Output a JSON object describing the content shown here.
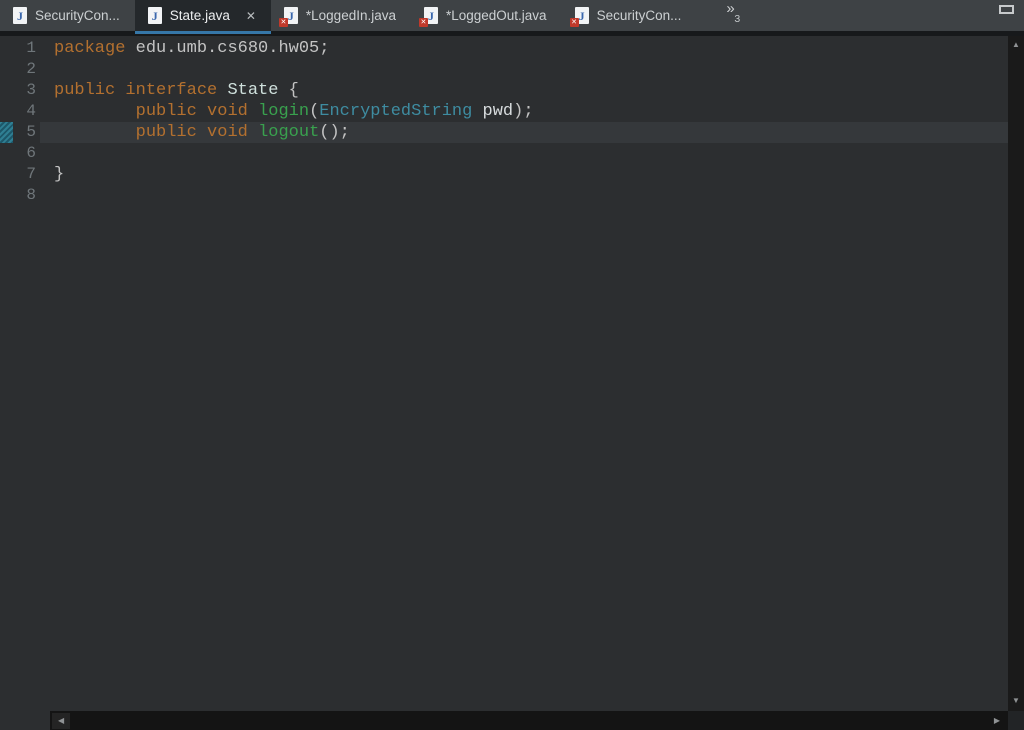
{
  "tab_bar": {
    "tabs": [
      {
        "label": "SecurityCon...",
        "active": false,
        "error": false
      },
      {
        "label": "State.java",
        "active": true,
        "error": false
      },
      {
        "label": "*LoggedIn.java",
        "active": false,
        "error": true
      },
      {
        "label": "*LoggedOut.java",
        "active": false,
        "error": true
      },
      {
        "label": "SecurityCon...",
        "active": false,
        "error": true
      }
    ],
    "overflow": {
      "chevron": "»",
      "count": "3"
    }
  },
  "icons": {
    "java_letter": "J",
    "error_x": "✕",
    "close": "✕",
    "up_arrow": "▲",
    "down_arrow": "▼",
    "left_arrow": "◀",
    "right_arrow": "▶"
  },
  "editor": {
    "current_line": 5,
    "token_colors": {
      "keyword": "#b3702f",
      "plain": "#c3c3c3",
      "method": "#39a14e",
      "iface": "#cfe0dc",
      "type": "#3e8ca1",
      "param": "#d8dcde"
    },
    "lines": [
      {
        "num": "1",
        "tokens": [
          [
            "keyword",
            "package"
          ],
          [
            "plain",
            " edu.umb.cs680.hw05;"
          ]
        ]
      },
      {
        "num": "2",
        "tokens": []
      },
      {
        "num": "3",
        "tokens": [
          [
            "keyword",
            "public"
          ],
          [
            "plain",
            " "
          ],
          [
            "keyword",
            "interface"
          ],
          [
            "plain",
            " "
          ],
          [
            "iface",
            "State"
          ],
          [
            "plain",
            " {"
          ]
        ]
      },
      {
        "num": "4",
        "tokens": [
          [
            "plain",
            "        "
          ],
          [
            "keyword",
            "public"
          ],
          [
            "plain",
            " "
          ],
          [
            "keyword",
            "void"
          ],
          [
            "plain",
            " "
          ],
          [
            "method",
            "login"
          ],
          [
            "plain",
            "("
          ],
          [
            "type",
            "EncryptedString"
          ],
          [
            "plain",
            " "
          ],
          [
            "param",
            "pwd"
          ],
          [
            "plain",
            ");"
          ]
        ]
      },
      {
        "num": "5",
        "tokens": [
          [
            "plain",
            "        "
          ],
          [
            "keyword",
            "public"
          ],
          [
            "plain",
            " "
          ],
          [
            "keyword",
            "void"
          ],
          [
            "plain",
            " "
          ],
          [
            "method",
            "logout"
          ],
          [
            "plain",
            "();"
          ]
        ]
      },
      {
        "num": "6",
        "tokens": []
      },
      {
        "num": "7",
        "tokens": [
          [
            "plain",
            "}"
          ]
        ]
      },
      {
        "num": "8",
        "tokens": []
      }
    ]
  },
  "colors": {
    "tab_bar_bg": "#3e4245",
    "tab_active_bg": "#24282b",
    "accent": "#3677a8",
    "editor_bg": "#2c2e30",
    "current_line_bg": "#35383b",
    "line_number": "#6f767a",
    "marker": "#2f7f93",
    "error_badge": "#c0392b",
    "file_icon_letter": "#3a67ad"
  }
}
